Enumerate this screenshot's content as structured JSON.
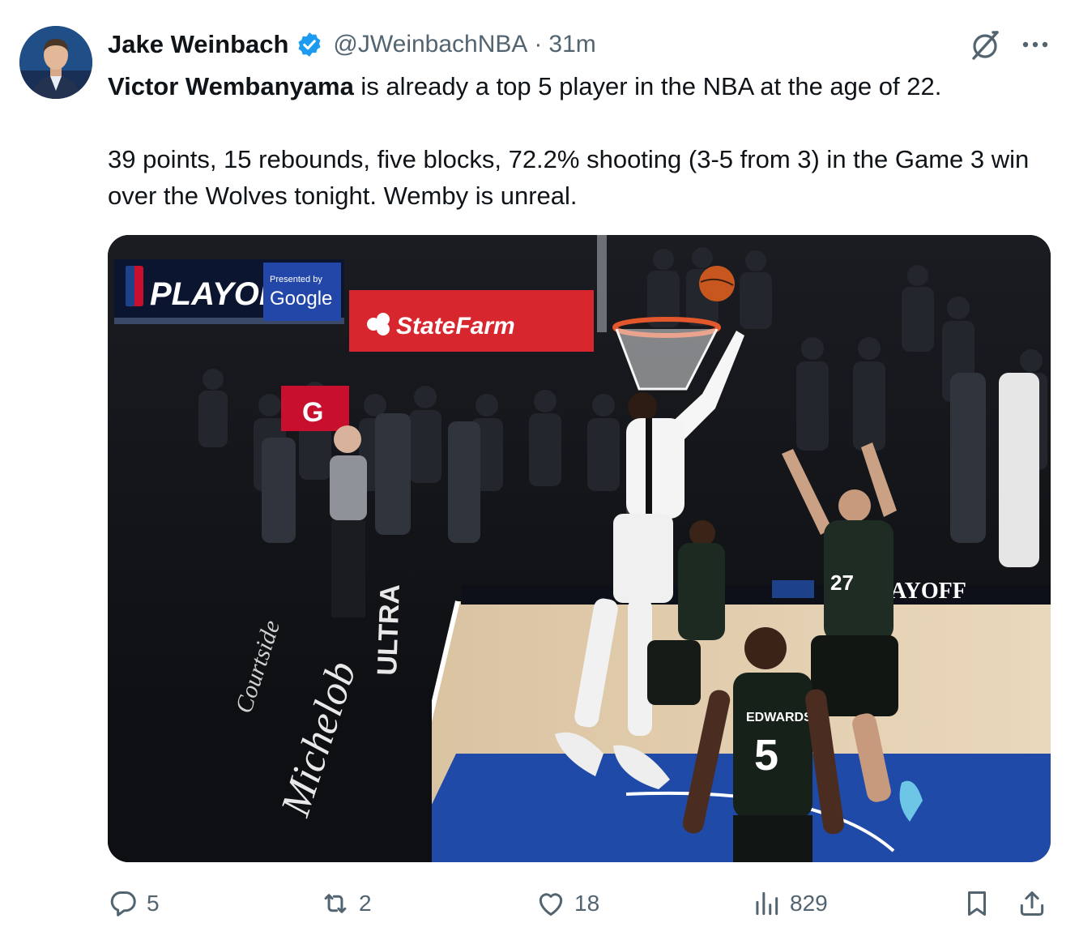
{
  "author": {
    "display_name": "Jake Weinbach",
    "handle": "@JWeinbachNBA",
    "separator": "·",
    "time": "31m",
    "verified_color": "#1d9bf0"
  },
  "tweet": {
    "mention": "Victor Wembanyama",
    "line1_rest": " is already a top 5 player in the NBA at the age of 22.",
    "paragraph2": "39 points, 15 rebounds, five blocks, 72.2% shooting (3-5 from 3) in the Game 3 win over the Wolves tonight. Wemby is unreal."
  },
  "media": {
    "signs": {
      "playoffs": "PLAYOFFS",
      "presented_by": "Presented by",
      "google": "Google",
      "state_farm": "StateFarm",
      "gatorade": "G",
      "baseline": "AYOFF",
      "floor_brand": "Michelob",
      "floor_ultra": "ULTRA",
      "floor_sub": "Courtside",
      "jersey_name": "EDWARDS",
      "jersey_number": "5",
      "jersey_number_2": "27"
    }
  },
  "actions": {
    "reply_count": "5",
    "retweet_count": "2",
    "like_count": "18",
    "views_count": "829"
  },
  "icons": {
    "verified": "verified-badge-icon",
    "grok": "grok-icon",
    "more": "more-dots-icon",
    "reply": "reply-icon",
    "retweet": "retweet-icon",
    "like": "heart-icon",
    "views": "views-chart-icon",
    "bookmark": "bookmark-icon",
    "share": "share-icon"
  },
  "colors": {
    "text": "#0f1419",
    "secondary": "#536471",
    "accent": "#1d9bf0"
  }
}
